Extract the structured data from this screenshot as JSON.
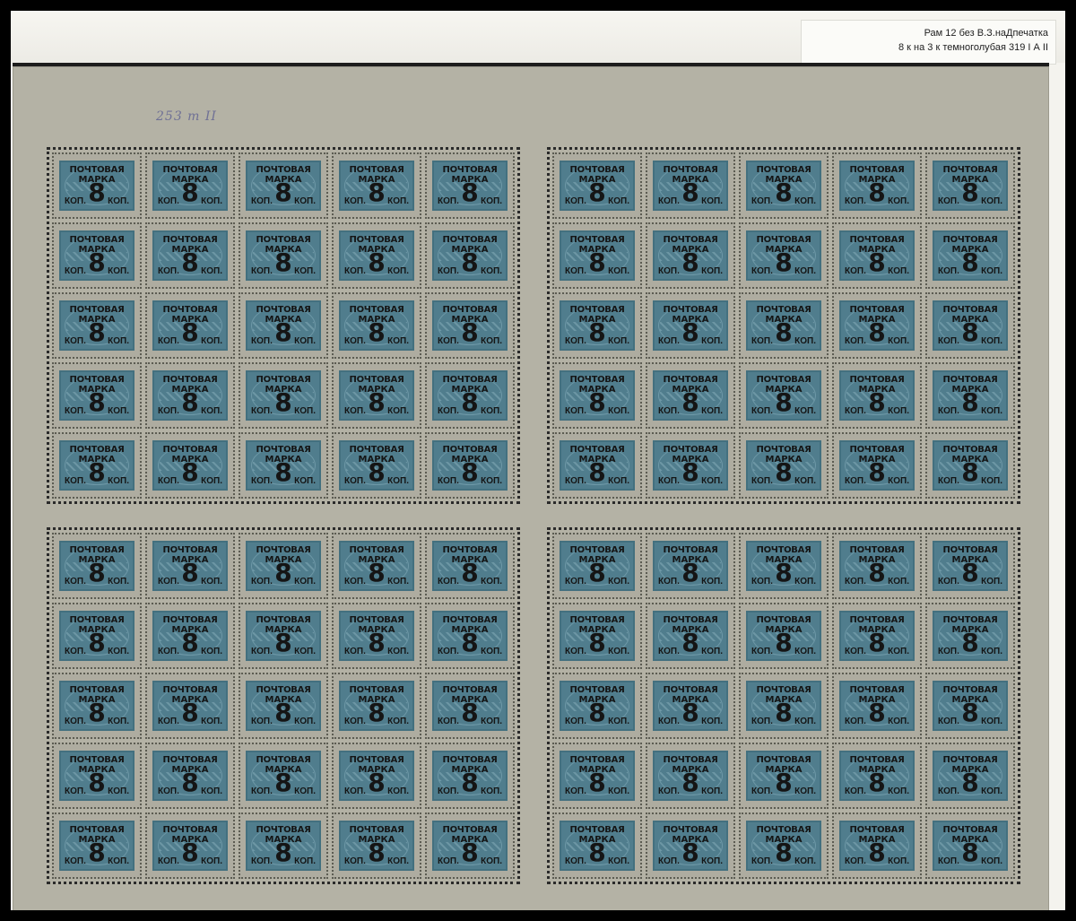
{
  "caption": {
    "line1": "Рам 12 без В.З.наДпечатка",
    "line2": "8 к на 3 к темноголубая 319 I А II"
  },
  "pencil_note": "253 т II",
  "stamp": {
    "line1": "ПОЧТОВАЯ",
    "line2": "МАРКА",
    "value": "8",
    "unit_left": "КОП.",
    "unit_right": "КОП."
  },
  "panes": [
    {
      "name": "pane-top-left",
      "rows": 5,
      "cols": 5
    },
    {
      "name": "pane-top-right",
      "rows": 5,
      "cols": 5
    },
    {
      "name": "pane-bottom-left",
      "rows": 5,
      "cols": 5
    },
    {
      "name": "pane-bottom-right",
      "rows": 5,
      "cols": 5
    }
  ],
  "colors": {
    "stamp_blue": "#507d8d",
    "sheet_paper": "#b4b2a5",
    "overprint": "#151515"
  }
}
